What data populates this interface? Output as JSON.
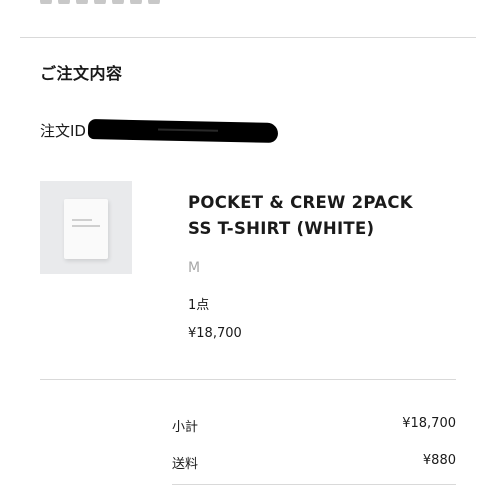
{
  "order_details": {
    "title": "ご注文内容",
    "order_id_label": "注文ID"
  },
  "product": {
    "name_line1": "POCKET & CREW 2PACK",
    "name_line2": "SS T-SHIRT (WHITE)",
    "size": "M",
    "quantity": "1点",
    "price": "¥18,700"
  },
  "summary": {
    "subtotal_label": "小計",
    "subtotal_value": "¥18,700",
    "shipping_label": "送料",
    "shipping_value": "¥880"
  },
  "colors": {
    "text": "#1a1a1a",
    "muted_text": "#a8a8a8",
    "divider": "#d9d9d9",
    "image_background": "#e9eaec",
    "redaction": "#000000"
  }
}
